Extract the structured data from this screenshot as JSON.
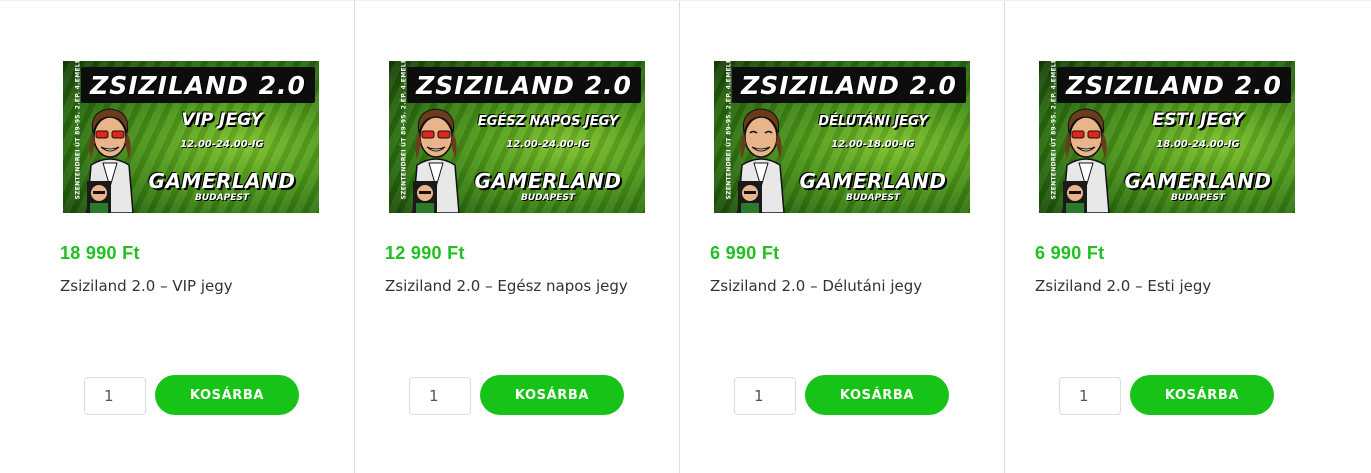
{
  "products": [
    {
      "banner": {
        "title": "ZSIZILAND 2.0",
        "ticket": "VIP JEGY",
        "hours": "12.00-24.00-IG",
        "brand": "GAMERLAND",
        "city": "BUDAPEST",
        "side_text": "SZENTENDREI ÚT 89-95. 2.ÉP. 4.EMELET"
      },
      "price": "18 990 Ft",
      "name": "Zsiziland 2.0 – VIP jegy",
      "quantity": "1",
      "button_label": "KOSÁRBA"
    },
    {
      "banner": {
        "title": "ZSIZILAND 2.0",
        "ticket": "EGÉSZ NAPOS JEGY",
        "hours": "12.00-24.00-IG",
        "brand": "GAMERLAND",
        "city": "BUDAPEST",
        "side_text": "SZENTENDREI ÚT 89-95. 2.ÉP. 4.EMELET"
      },
      "price": "12 990 Ft",
      "name": "Zsiziland 2.0 – Egész napos jegy",
      "quantity": "1",
      "button_label": "KOSÁRBA"
    },
    {
      "banner": {
        "title": "ZSIZILAND 2.0",
        "ticket": "DÉLUTÁNI JEGY",
        "hours": "12.00-18.00-IG",
        "brand": "GAMERLAND",
        "city": "BUDAPEST",
        "side_text": "SZENTENDREI ÚT 89-95. 2.ÉP. 4.EMELET"
      },
      "price": "6 990 Ft",
      "name": "Zsiziland 2.0 – Délutáni jegy",
      "quantity": "1",
      "button_label": "KOSÁRBA"
    },
    {
      "banner": {
        "title": "ZSIZILAND 2.0",
        "ticket": "ESTI JEGY",
        "hours": "18.00-24.00-IG",
        "brand": "GAMERLAND",
        "city": "BUDAPEST",
        "side_text": "SZENTENDREI ÚT 89-95. 2.ÉP. 4.EMELET"
      },
      "price": "6 990 Ft",
      "name": "Zsiziland 2.0 – Esti jegy",
      "quantity": "1",
      "button_label": "KOSÁRBA"
    }
  ],
  "colors": {
    "accent": "#18c318",
    "price": "#20c020",
    "text": "#333333",
    "divider": "#dcdcdc"
  }
}
